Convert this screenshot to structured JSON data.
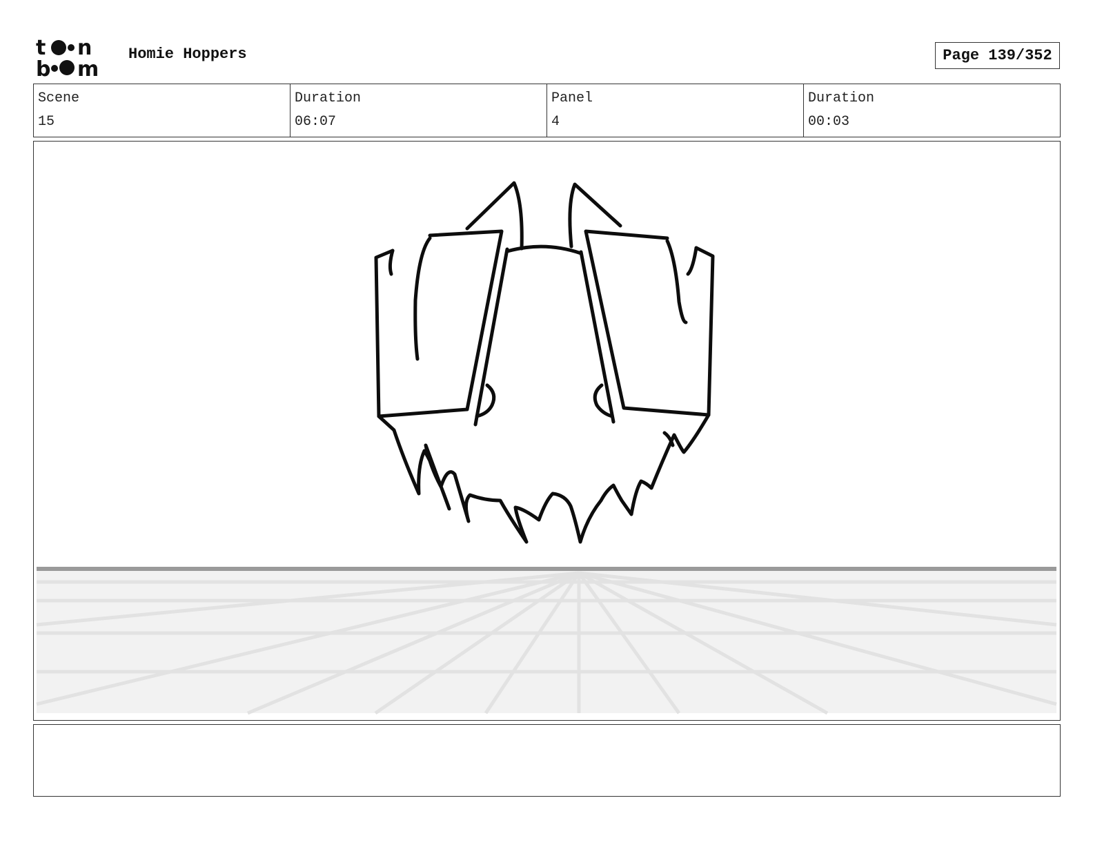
{
  "header": {
    "logo_text": "toon boom",
    "project_title": "Homie Hoppers",
    "page_label": "Page 139/352"
  },
  "info": [
    {
      "label": "Scene",
      "value": "15"
    },
    {
      "label": "Duration",
      "value": "06:07"
    },
    {
      "label": "Panel",
      "value": "4"
    },
    {
      "label": "Duration",
      "value": "00:03"
    }
  ],
  "notes": ""
}
